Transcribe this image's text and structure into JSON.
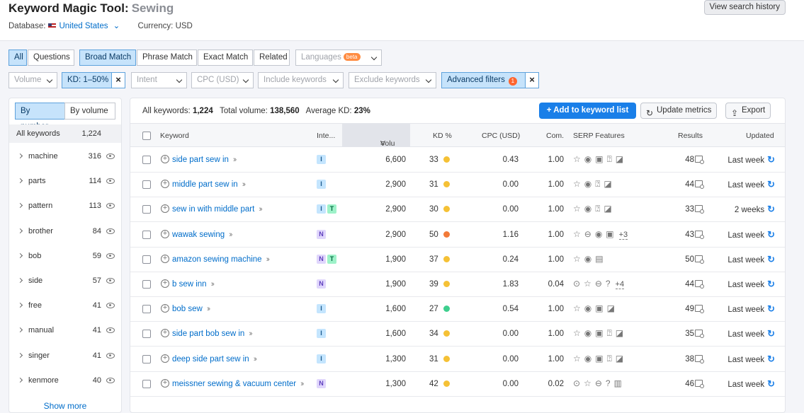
{
  "header": {
    "title": "Keyword Magic Tool:",
    "keyword": "Sewing",
    "database_label": "Database:",
    "database_value": "United States",
    "currency": "Currency: USD",
    "view_history": "View search history"
  },
  "match_tabs": [
    "All",
    "Questions",
    "Broad Match",
    "Phrase Match",
    "Exact Match",
    "Related"
  ],
  "languages": {
    "label": "Languages",
    "beta": "beta"
  },
  "filters": {
    "volume": "Volume",
    "kd": "KD: 1–50%",
    "intent": "Intent",
    "cpc": "CPC (USD)",
    "include": "Include keywords",
    "exclude": "Exclude keywords",
    "advanced": "Advanced filters",
    "advanced_count": "1",
    "clear": "×"
  },
  "sidebar": {
    "by_number": "By number",
    "by_volume": "By volume",
    "all_label": "All keywords",
    "all_count": "1,224",
    "groups": [
      {
        "label": "machine",
        "count": "316"
      },
      {
        "label": "parts",
        "count": "114"
      },
      {
        "label": "pattern",
        "count": "113"
      },
      {
        "label": "brother",
        "count": "84"
      },
      {
        "label": "bob",
        "count": "59"
      },
      {
        "label": "side",
        "count": "57"
      },
      {
        "label": "free",
        "count": "41"
      },
      {
        "label": "manual",
        "count": "41"
      },
      {
        "label": "singer",
        "count": "41"
      },
      {
        "label": "kenmore",
        "count": "40"
      }
    ],
    "show_more": "Show more"
  },
  "summary": {
    "all_label": "All keywords:",
    "all_value": "1,224",
    "vol_label": "Total volume:",
    "vol_value": "138,560",
    "kd_label": "Average KD:",
    "kd_value": "23%"
  },
  "actions": {
    "add": "Add to keyword list",
    "update": "Update metrics",
    "export": "Export"
  },
  "columns": [
    "Keyword",
    "Inte...",
    "Volu",
    "KD %",
    "CPC (USD)",
    "Com.",
    "SERP Features",
    "Results",
    "Updated"
  ],
  "rows": [
    {
      "keyword": "side part sew in",
      "intents": [
        "I"
      ],
      "volume": "6,600",
      "kd": "33",
      "kd_color": "#f5c135",
      "cpc": "0.43",
      "com": "1.00",
      "serp": "☆◉▣⍰◪",
      "serp_more": "",
      "results": "48",
      "updated": "Last week"
    },
    {
      "keyword": "middle part sew in",
      "intents": [
        "I"
      ],
      "volume": "2,900",
      "kd": "31",
      "kd_color": "#f5c135",
      "cpc": "0.00",
      "com": "1.00",
      "serp": "☆◉⍰◪",
      "serp_more": "",
      "results": "44",
      "updated": "Last week"
    },
    {
      "keyword": "sew in with middle part",
      "intents": [
        "I",
        "T"
      ],
      "volume": "2,900",
      "kd": "30",
      "kd_color": "#f5c135",
      "cpc": "0.00",
      "com": "1.00",
      "serp": "☆◉⍰◪",
      "serp_more": "",
      "results": "33",
      "updated": "2 weeks"
    },
    {
      "keyword": "wawak sewing",
      "intents": [
        "N"
      ],
      "volume": "2,900",
      "kd": "50",
      "kd_color": "#f27a38",
      "cpc": "1.16",
      "com": "1.00",
      "serp": "☆⊖◉▣",
      "serp_more": "+3",
      "results": "43",
      "updated": "Last week"
    },
    {
      "keyword": "amazon sewing machine",
      "intents": [
        "N",
        "T"
      ],
      "volume": "1,900",
      "kd": "37",
      "kd_color": "#f5c135",
      "cpc": "0.24",
      "com": "1.00",
      "serp": "☆◉▤",
      "serp_more": "",
      "results": "50",
      "updated": "Last week"
    },
    {
      "keyword": "b sew inn",
      "intents": [
        "N"
      ],
      "volume": "1,900",
      "kd": "39",
      "kd_color": "#f5c135",
      "cpc": "1.83",
      "com": "0.04",
      "serp": "⊙☆⊖?",
      "serp_more": "+4",
      "results": "44",
      "updated": "Last week"
    },
    {
      "keyword": "bob sew",
      "intents": [
        "I"
      ],
      "volume": "1,600",
      "kd": "27",
      "kd_color": "#3ecf8e",
      "cpc": "0.54",
      "com": "1.00",
      "serp": "☆◉▣◪",
      "serp_more": "",
      "results": "49",
      "updated": "Last week"
    },
    {
      "keyword": "side part bob sew in",
      "intents": [
        "I"
      ],
      "volume": "1,600",
      "kd": "34",
      "kd_color": "#f5c135",
      "cpc": "0.00",
      "com": "1.00",
      "serp": "☆◉▣⍰◪",
      "serp_more": "",
      "results": "35",
      "updated": "Last week"
    },
    {
      "keyword": "deep side part sew in",
      "intents": [
        "I"
      ],
      "volume": "1,300",
      "kd": "31",
      "kd_color": "#f5c135",
      "cpc": "0.00",
      "com": "1.00",
      "serp": "☆◉▣⍰◪",
      "serp_more": "",
      "results": "38",
      "updated": "Last week"
    },
    {
      "keyword": "meissner sewing & vacuum center",
      "intents": [
        "N"
      ],
      "volume": "1,300",
      "kd": "42",
      "kd_color": "#f5c135",
      "cpc": "0.00",
      "com": "0.02",
      "serp": "⊙☆⊖?▥",
      "serp_more": "",
      "results": "46",
      "updated": "Last week"
    }
  ]
}
